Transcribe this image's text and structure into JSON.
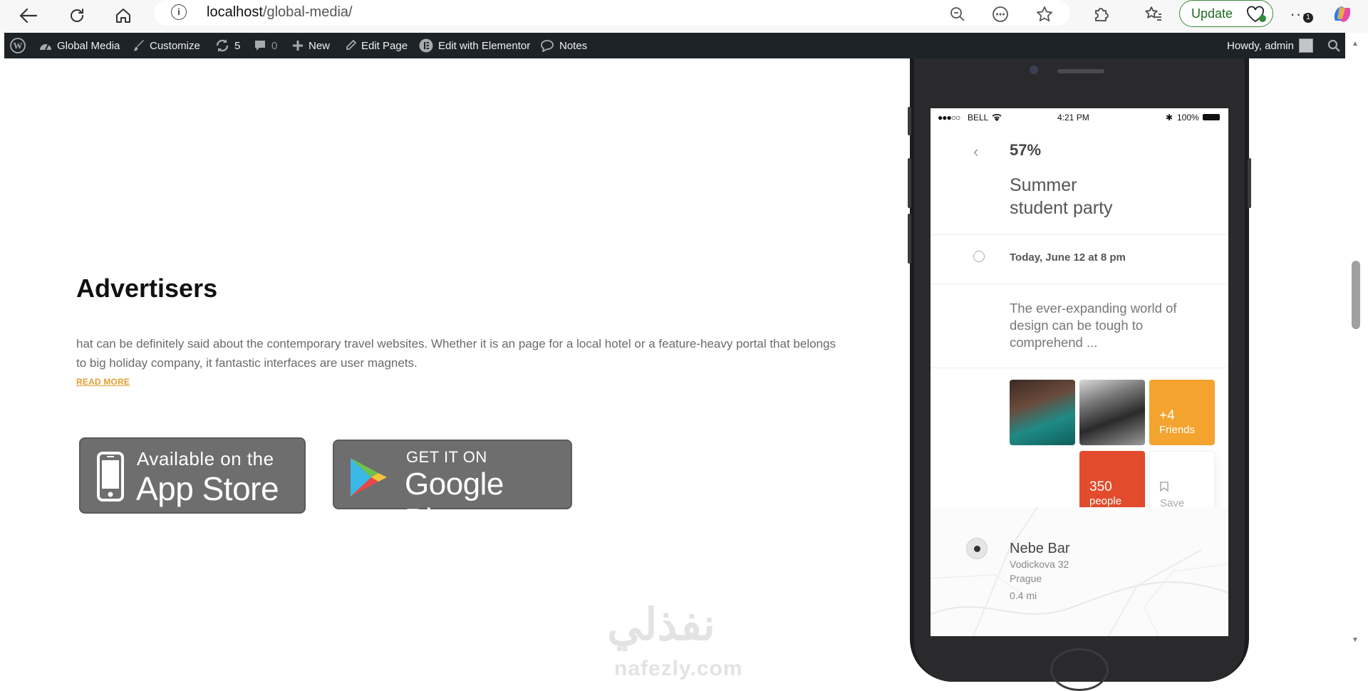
{
  "browser": {
    "url_host": "localhost",
    "url_path": "/global-media/",
    "update_label": "Update",
    "notification_badge": "1"
  },
  "wpbar": {
    "site_name": "Global Media",
    "customize": "Customize",
    "updates_count": "5",
    "comments_count": "0",
    "new": "New",
    "edit_page": "Edit Page",
    "edit_elementor": "Edit with Elementor",
    "notes": "Notes",
    "howdy": "Howdy, admin"
  },
  "advertisers": {
    "title": "Advertisers",
    "text": "hat can be definitely said about the contemporary travel websites. Whether it is an page for a local hotel or a feature-heavy portal that belongs to big holiday company, it fantastic interfaces are user magnets.",
    "read_more": "READ MORE"
  },
  "badges": {
    "appstore_top": "Available on the",
    "appstore_main": "App Store",
    "play_top": "GET IT ON",
    "play_main": "Google Play"
  },
  "phone": {
    "status_carrier": "BELL",
    "status_time": "4:21 PM",
    "status_battery": "100%",
    "percent": "57%",
    "title_line1": "Summer",
    "title_line2": "student party",
    "date": "Today, June 12 at 8 pm",
    "description": "The ever-expanding world of design can be tough to comprehend ...",
    "friends_count": "+4",
    "friends_label": "Friends",
    "people_count": "350",
    "people_label": "people",
    "save_label": "Save",
    "place_name": "Nebe Bar",
    "place_street": "Vodickova 32",
    "place_city": "Prague",
    "place_distance": "0.4 mi"
  },
  "watermark": {
    "arabic": "نفذلي",
    "latin": "nafezly.com"
  }
}
